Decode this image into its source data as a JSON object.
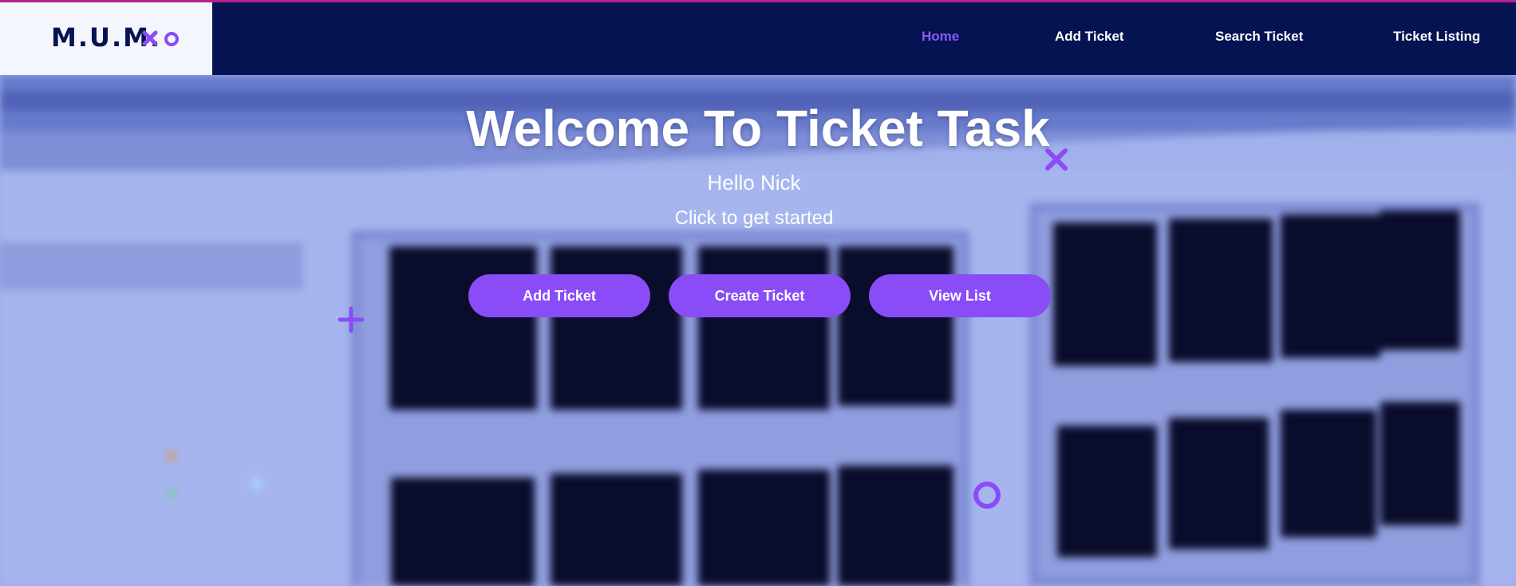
{
  "brand": {
    "logo_text": "M.U.M."
  },
  "nav": {
    "items": [
      {
        "label": "Home",
        "active": true
      },
      {
        "label": "Add Ticket",
        "active": false
      },
      {
        "label": "Search Ticket",
        "active": false
      },
      {
        "label": "Ticket Listing",
        "active": false
      }
    ]
  },
  "hero": {
    "title": "Welcome To Ticket Task",
    "greeting": "Hello Nick",
    "prompt": "Click to get started",
    "buttons": [
      {
        "label": "Add Ticket"
      },
      {
        "label": "Create Ticket"
      },
      {
        "label": "View List"
      }
    ]
  },
  "colors": {
    "navbar": "#061352",
    "accent": "#8a4cf7",
    "active_nav": "#8a5cf6",
    "top_line": "#b4208c",
    "logo_bg": "#f3f6fc"
  },
  "icons": {
    "logo_mark_1": "x-mark-icon",
    "logo_mark_2": "circle-icon",
    "decor": [
      "x-mark-icon",
      "plus-icon",
      "circle-icon"
    ]
  }
}
